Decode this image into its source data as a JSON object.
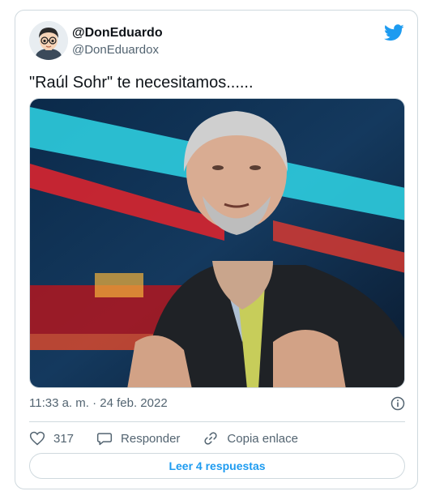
{
  "tweet": {
    "display_name": "@DonEduardo",
    "handle": "@DonEduardox",
    "text": "\"Raúl Sohr\" te necesitamos......",
    "timestamp": "11:33 a. m. · 24 feb. 2022",
    "likes": "317",
    "reply_label": "Responder",
    "copy_link_label": "Copia enlace",
    "read_replies_label": "Leer 4 respuestas"
  },
  "colors": {
    "accent": "#1d9bf0",
    "secondary_text": "#536471",
    "border": "#cfd9de"
  },
  "icons": {
    "brand": "twitter-bird-icon",
    "like": "heart-icon",
    "reply": "speech-bubble-icon",
    "copy": "link-icon",
    "info": "info-icon"
  }
}
